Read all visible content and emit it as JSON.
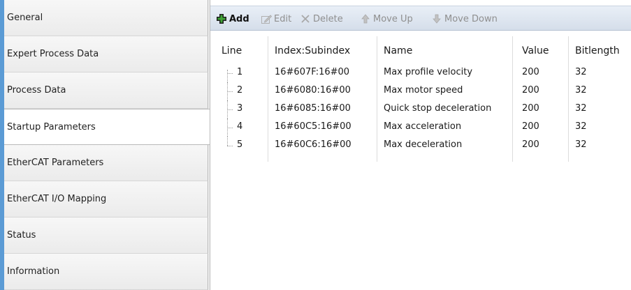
{
  "sidebar": {
    "items": [
      {
        "label": "General"
      },
      {
        "label": "Expert Process Data"
      },
      {
        "label": "Process Data"
      },
      {
        "label": "Startup Parameters"
      },
      {
        "label": "EtherCAT Parameters"
      },
      {
        "label": "EtherCAT I/O Mapping"
      },
      {
        "label": "Status"
      },
      {
        "label": "Information"
      }
    ],
    "active": "Startup Parameters"
  },
  "toolbar": {
    "add_label": "Add",
    "edit_label": "Edit",
    "delete_label": "Delete",
    "move_up_label": "Move Up",
    "move_down_label": "Move Down"
  },
  "table": {
    "headers": {
      "line": "Line",
      "index": "Index:Subindex",
      "name": "Name",
      "value": "Value",
      "bitlength": "Bitlength"
    },
    "rows": [
      {
        "line": "1",
        "index": "16#607F:16#00",
        "name": "Max profile velocity",
        "value": "200",
        "bitlength": "32"
      },
      {
        "line": "2",
        "index": "16#6080:16#00",
        "name": "Max motor speed",
        "value": "200",
        "bitlength": "32"
      },
      {
        "line": "3",
        "index": "16#6085:16#00",
        "name": "Quick stop deceleration",
        "value": "200",
        "bitlength": "32"
      },
      {
        "line": "4",
        "index": "16#60C5:16#00",
        "name": "Max acceleration",
        "value": "200",
        "bitlength": "32"
      },
      {
        "line": "5",
        "index": "16#60C6:16#00",
        "name": "Max deceleration",
        "value": "200",
        "bitlength": "32"
      }
    ]
  },
  "colors": {
    "accent": "#5b9bd5",
    "toolbar_bg": "#dbe3ee",
    "disabled_text": "#8f8f8f"
  }
}
